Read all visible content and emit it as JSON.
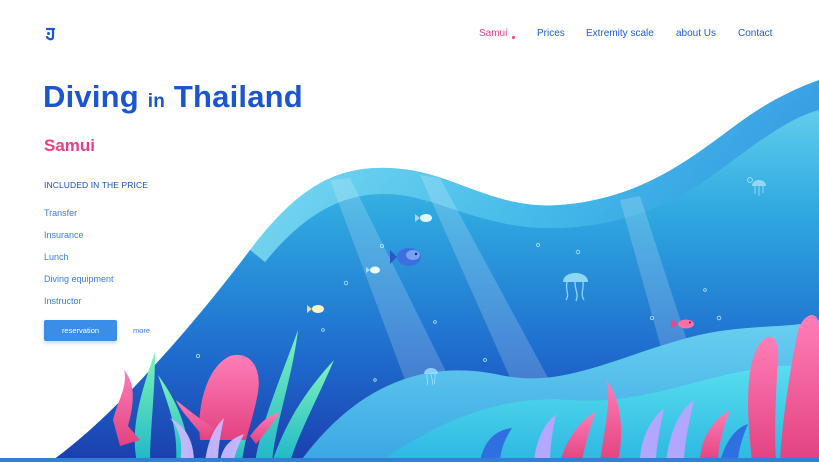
{
  "nav": {
    "items": [
      {
        "label": "Samui",
        "active": true
      },
      {
        "label": "Prices",
        "active": false
      },
      {
        "label": "Extremity scale",
        "active": false
      },
      {
        "label": "about Us",
        "active": false
      },
      {
        "label": "Contact",
        "active": false
      }
    ]
  },
  "hero": {
    "title_word1": "Diving",
    "title_word2": "in",
    "title_word3": "Thailand",
    "location": "Samui",
    "included_heading": "INCLUDED IN THE PRICE",
    "features": [
      "Transfer",
      "Insurance",
      "Lunch",
      "Diving equipment",
      "Instructor"
    ],
    "reservation_label": "reservation",
    "more_label": "more"
  },
  "colors": {
    "brand_blue": "#1b55d0",
    "accent_pink": "#e83f87",
    "button_blue": "#3b8ee8"
  },
  "icons": {
    "logo": "brand-logo-icon"
  }
}
